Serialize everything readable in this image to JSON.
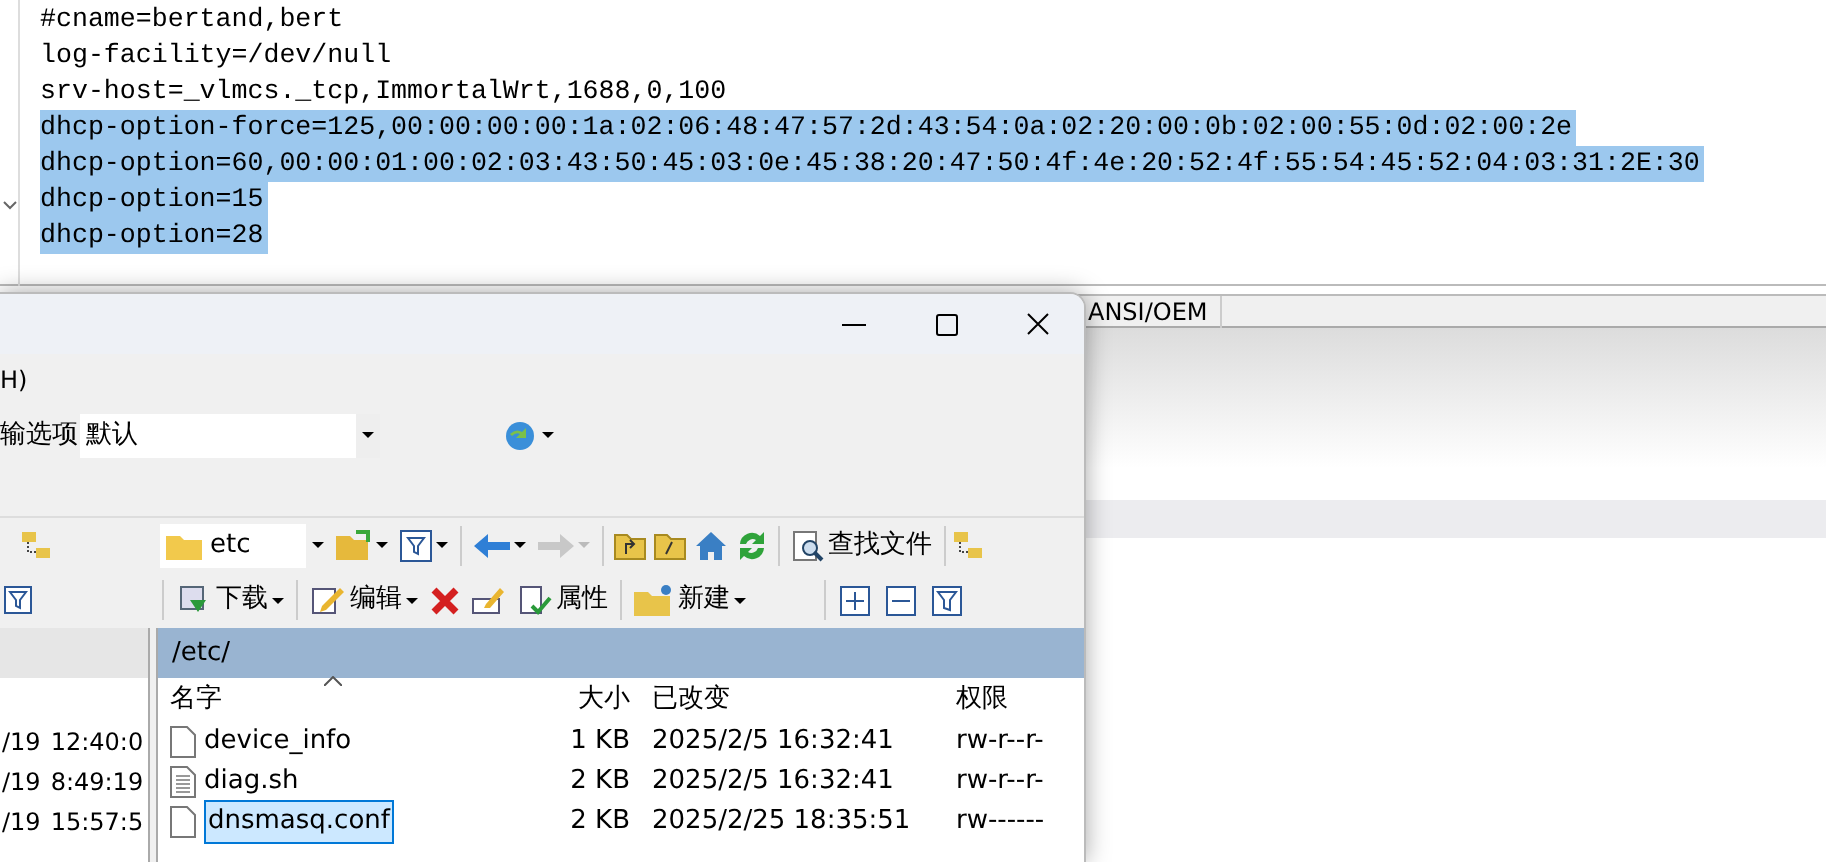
{
  "editor": {
    "lines": [
      {
        "text": "#cname=bertand,bert",
        "selected": false
      },
      {
        "text": "log-facility=/dev/null",
        "selected": false
      },
      {
        "text": "srv-host=_vlmcs._tcp,ImmortalWrt,1688,0,100",
        "selected": false
      },
      {
        "text": "dhcp-option-force=125,00:00:00:00:1a:02:06:48:47:57:2d:43:54:0a:02:20:00:0b:02:00:55:0d:02:00:2e",
        "selected": true
      },
      {
        "text": "dhcp-option=60,00:00:01:00:02:03:43:50:45:03:0e:45:38:20:47:50:4f:4e:20:52:4f:55:54:45:52:04:03:31:2E:30",
        "selected": true
      },
      {
        "text": "dhcp-option=15",
        "selected": true
      },
      {
        "text": "dhcp-option=28",
        "selected": true
      }
    ],
    "status": "ANSI/OEM"
  },
  "file_window": {
    "menu_fragment": "H)",
    "transfer_label": "输选项",
    "transfer_value": "默认",
    "folder": "etc",
    "find_button": "查找文件",
    "toolbar": [
      "下载",
      "编辑",
      "属性",
      "新建"
    ],
    "path": "/etc/",
    "columns": [
      "名字",
      "大小",
      "已改变",
      "权限"
    ],
    "left_rows": [
      {
        "date": "/19",
        "time": "12:40:0"
      },
      {
        "date": "/19",
        "time": "8:49:19"
      },
      {
        "date": "/19",
        "time": "15:57:5"
      }
    ],
    "files": [
      {
        "name": "device_info",
        "size": "1 KB",
        "modified": "2025/2/5 16:32:41",
        "permissions": "rw-r--r-",
        "kind": "file",
        "selected": false
      },
      {
        "name": "diag.sh",
        "size": "2 KB",
        "modified": "2025/2/5 16:32:41",
        "permissions": "rw-r--r-",
        "kind": "script",
        "selected": false
      },
      {
        "name": "dnsmasq.conf",
        "size": "2 KB",
        "modified": "2025/2/25 18:35:51",
        "permissions": "rw------",
        "kind": "file",
        "selected": true
      }
    ]
  }
}
